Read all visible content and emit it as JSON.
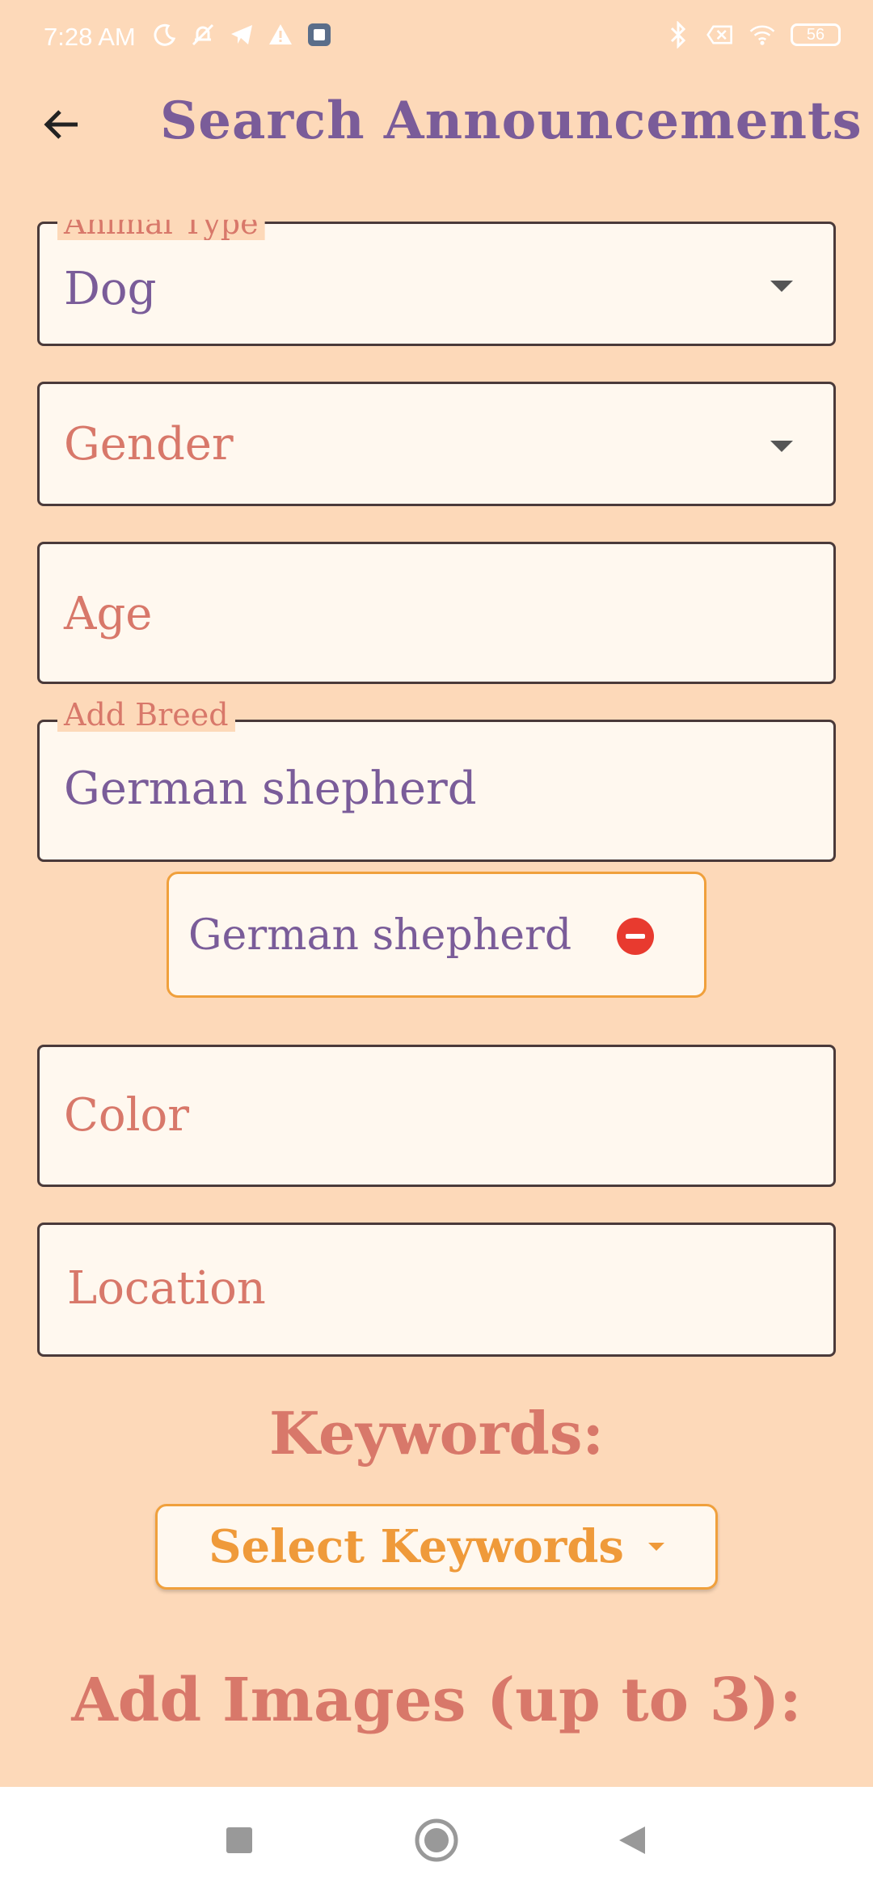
{
  "status_bar": {
    "time": "7:28 AM",
    "battery": "56",
    "icons_left": [
      "moon-icon",
      "bell-off-icon",
      "telegram-icon",
      "warning-icon",
      "app-icon"
    ],
    "icons_right": [
      "bluetooth-icon",
      "sim-off-icon",
      "wifi-icon",
      "battery-icon"
    ]
  },
  "app_bar": {
    "title": "Search Announcements",
    "back_icon": "arrow-left-icon"
  },
  "form": {
    "animal_type": {
      "label": "Animal Type",
      "value": "Dog"
    },
    "gender": {
      "placeholder": "Gender"
    },
    "age": {
      "placeholder": "Age"
    },
    "breed": {
      "label": "Add Breed",
      "value": "German shepherd"
    },
    "breed_chip": {
      "label": "German shepherd",
      "remove_icon": "remove-circle-icon"
    },
    "color": {
      "placeholder": "Color"
    },
    "location": {
      "placeholder": "Location"
    }
  },
  "keywords": {
    "title": "Keywords:",
    "button_label": "Select Keywords"
  },
  "images": {
    "title": "Add Images (up to 3):"
  },
  "colors": {
    "background": "#fdd9b9",
    "field_bg": "#fff8ef",
    "primary_text": "#7a5c99",
    "placeholder_text": "#d8786a",
    "accent": "#ef9a3a",
    "remove": "#e83a2f"
  },
  "nav_bar": {
    "buttons": [
      "square-recents-icon",
      "circle-home-icon",
      "triangle-back-icon"
    ]
  }
}
